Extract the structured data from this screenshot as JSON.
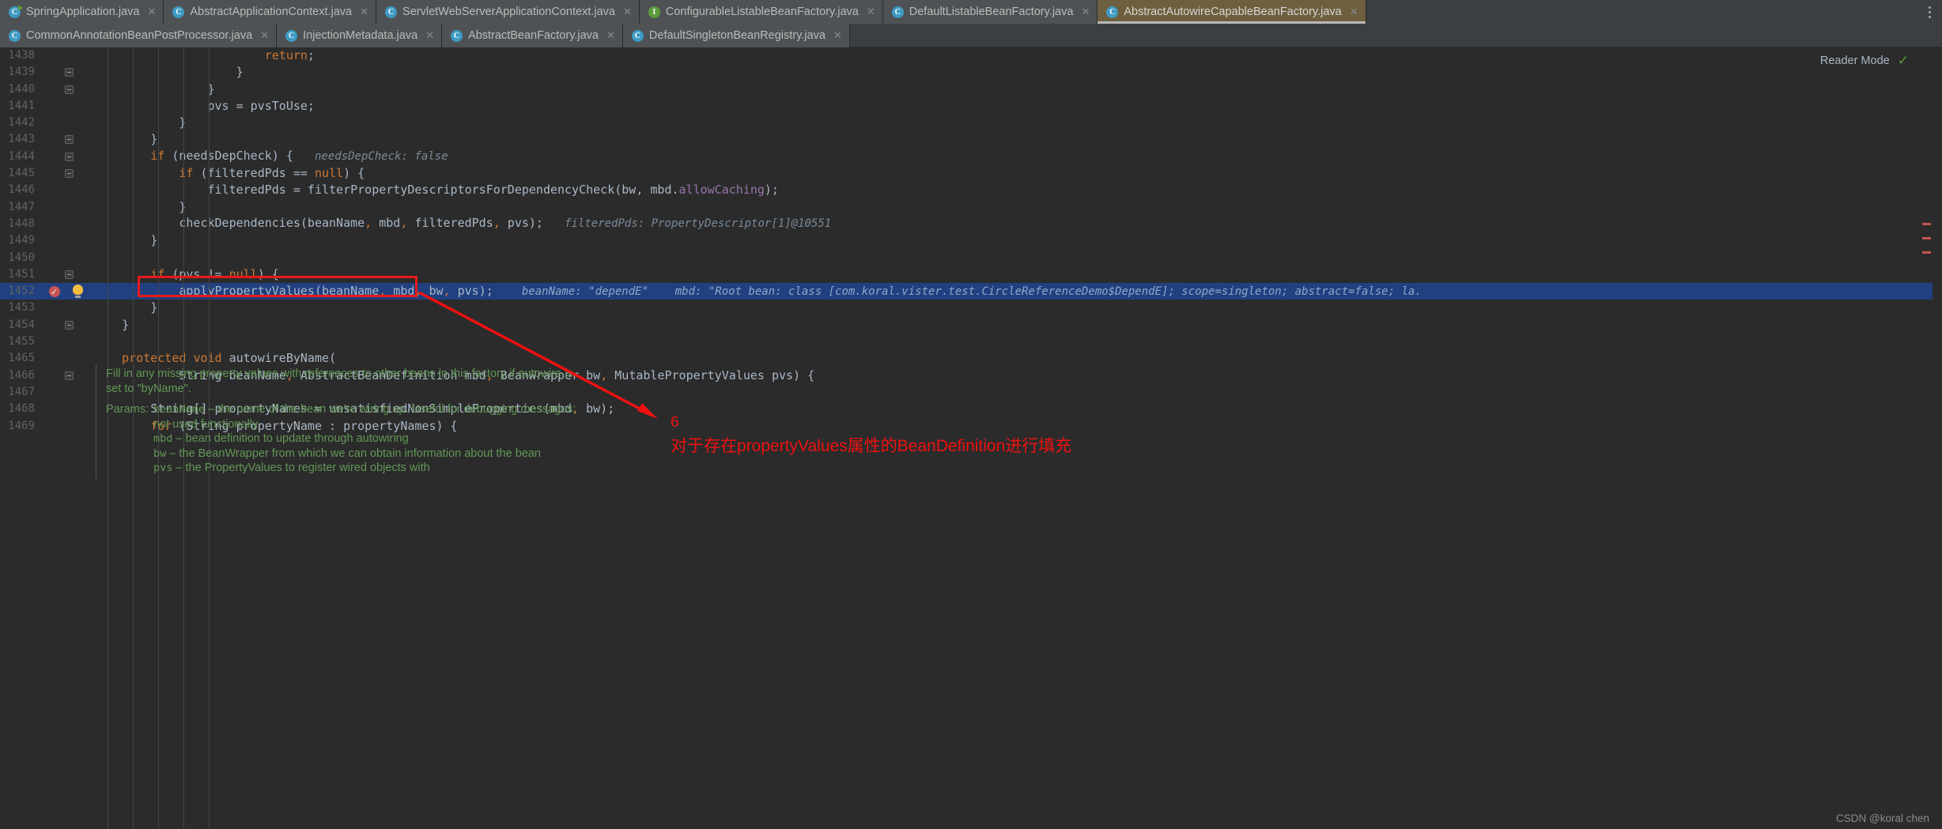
{
  "window": {
    "reader_mode_label": "Reader Mode",
    "reader_mode_icon": "check-icon",
    "tab_overflow_icon": "vertical-dots-icon",
    "watermark": "CSDN @koral chen"
  },
  "tabs": {
    "row1": [
      {
        "label": "SpringApplication.java",
        "icon": "class-runnable-icon",
        "kind": "class-run",
        "active": false,
        "close_icon": "close-icon"
      },
      {
        "label": "AbstractApplicationContext.java",
        "icon": "abstract-class-icon",
        "kind": "class-abstract",
        "active": false,
        "close_icon": "close-icon"
      },
      {
        "label": "ServletWebServerApplicationContext.java",
        "icon": "class-icon",
        "kind": "class",
        "active": false,
        "close_icon": "close-icon"
      },
      {
        "label": "ConfigurableListableBeanFactory.java",
        "icon": "interface-icon",
        "kind": "interface",
        "active": false,
        "close_icon": "close-icon"
      },
      {
        "label": "DefaultListableBeanFactory.java",
        "icon": "class-icon",
        "kind": "class",
        "active": false,
        "close_icon": "close-icon"
      },
      {
        "label": "AbstractAutowireCapableBeanFactory.java",
        "icon": "abstract-class-icon",
        "kind": "class-abstract",
        "active": true,
        "close_icon": "close-icon"
      }
    ],
    "row2": [
      {
        "label": "CommonAnnotationBeanPostProcessor.java",
        "icon": "class-icon",
        "kind": "class",
        "active": false,
        "close_icon": "close-icon"
      },
      {
        "label": "InjectionMetadata.java",
        "icon": "class-icon",
        "kind": "class",
        "active": false,
        "close_icon": "close-icon"
      },
      {
        "label": "AbstractBeanFactory.java",
        "icon": "abstract-class-icon",
        "kind": "class-abstract",
        "active": false,
        "close_icon": "close-icon"
      },
      {
        "label": "DefaultSingletonBeanRegistry.java",
        "icon": "class-icon",
        "kind": "class",
        "active": false,
        "close_icon": "close-icon"
      }
    ]
  },
  "editor": {
    "lines": [
      {
        "num": "1438",
        "indent": 0,
        "html": "                        <k>return</k>;"
      },
      {
        "num": "1439",
        "indent": 0,
        "html": "                    }",
        "fold": true
      },
      {
        "num": "1440",
        "indent": 0,
        "html": "                }",
        "fold": true
      },
      {
        "num": "1441",
        "indent": 0,
        "html": "                pvs = pvsToUse;"
      },
      {
        "num": "1442",
        "indent": 0,
        "html": "            }"
      },
      {
        "num": "1443",
        "indent": 0,
        "html": "        }",
        "fold": true
      },
      {
        "num": "1444",
        "indent": 0,
        "html": "        <k>if</k> (needsDepCheck) {   <h>needsDepCheck: false</h>",
        "fold": true
      },
      {
        "num": "1445",
        "indent": 0,
        "html": "            <k>if</k> (filteredPds == <k>null</k>) {",
        "fold": true
      },
      {
        "num": "1446",
        "indent": 0,
        "html": "                filteredPds = filterPropertyDescriptorsForDependencyCheck(bw, mbd.<f>allowCaching</f>);"
      },
      {
        "num": "1447",
        "indent": 0,
        "html": "            }"
      },
      {
        "num": "1448",
        "indent": 0,
        "html": "            checkDependencies(beanName<c>,</c> mbd<c>,</c> filteredPds<c>,</c> pvs);   <h>filteredPds: PropertyDescriptor[1]@10551</h>"
      },
      {
        "num": "1449",
        "indent": 0,
        "html": "        }"
      },
      {
        "num": "1450",
        "indent": 0,
        "html": ""
      },
      {
        "num": "1451",
        "indent": 0,
        "html": "        <k>if</k> (pvs != <k>null</k>) {",
        "fold": true
      },
      {
        "num": "1452",
        "indent": 0,
        "html": "            applyPropertyValues(beanName<c>,</c> mbd<c>,</c> bw<c>,</c> pvs);",
        "highlight": true,
        "breakpoint": true,
        "bulb": true,
        "inline_hint": "beanName: \"dependE\"    mbd: \"Root bean: class [com.koral.vister.test.CircleReferenceDemo$DependE]; scope=singleton; abstract=false; la."
      },
      {
        "num": "1453",
        "indent": 0,
        "html": "        }"
      },
      {
        "num": "1454",
        "indent": 0,
        "html": "    }",
        "fold": true
      },
      {
        "num": "1455",
        "indent": 0,
        "html": ""
      },
      {
        "num": "1465",
        "indent": 0,
        "html": "    <k>protected</k> <k>void</k> <m>autowireByName</m>("
      },
      {
        "num": "1466",
        "indent": 0,
        "html": "            String beanName<c>,</c> AbstractBeanDefinition mbd<c>,</c> BeanWrapper bw<c>,</c> MutablePropertyValues pvs) {",
        "fold": true
      },
      {
        "num": "1467",
        "indent": 0,
        "html": ""
      },
      {
        "num": "1468",
        "indent": 0,
        "html": "        String[] propertyNames = unsatisfiedNonSimpleProperties(mbd<c>,</c> bw);"
      },
      {
        "num": "1469",
        "indent": 0,
        "html": "        <k>for</k> (String propertyName : propertyNames) {"
      }
    ],
    "javadoc": {
      "paragraph": "Fill in any missing property values with references to other beans in this factory if autowire is set to \"byName\".",
      "params_label": "Params:",
      "params": [
        {
          "name": "beanName",
          "desc": "– the name of the bean we're wiring up. Useful for debugging messages; not used functionally."
        },
        {
          "name": "mbd",
          "desc": "– bean definition to update through autowiring"
        },
        {
          "name": "bw",
          "desc": "– the BeanWrapper from which we can obtain information about the bean"
        },
        {
          "name": "pvs",
          "desc": "– the PropertyValues to register wired objects with"
        }
      ]
    },
    "annotation": {
      "step_number": "6",
      "text": "对于存在propertyValues属性的BeanDefinition进行填充"
    }
  },
  "colors": {
    "accent_red": "#e81919",
    "highlight_blue": "#204080",
    "active_tab": "#6e5f3e",
    "javadoc_green": "#629755",
    "keyword_orange": "#cc7832"
  }
}
